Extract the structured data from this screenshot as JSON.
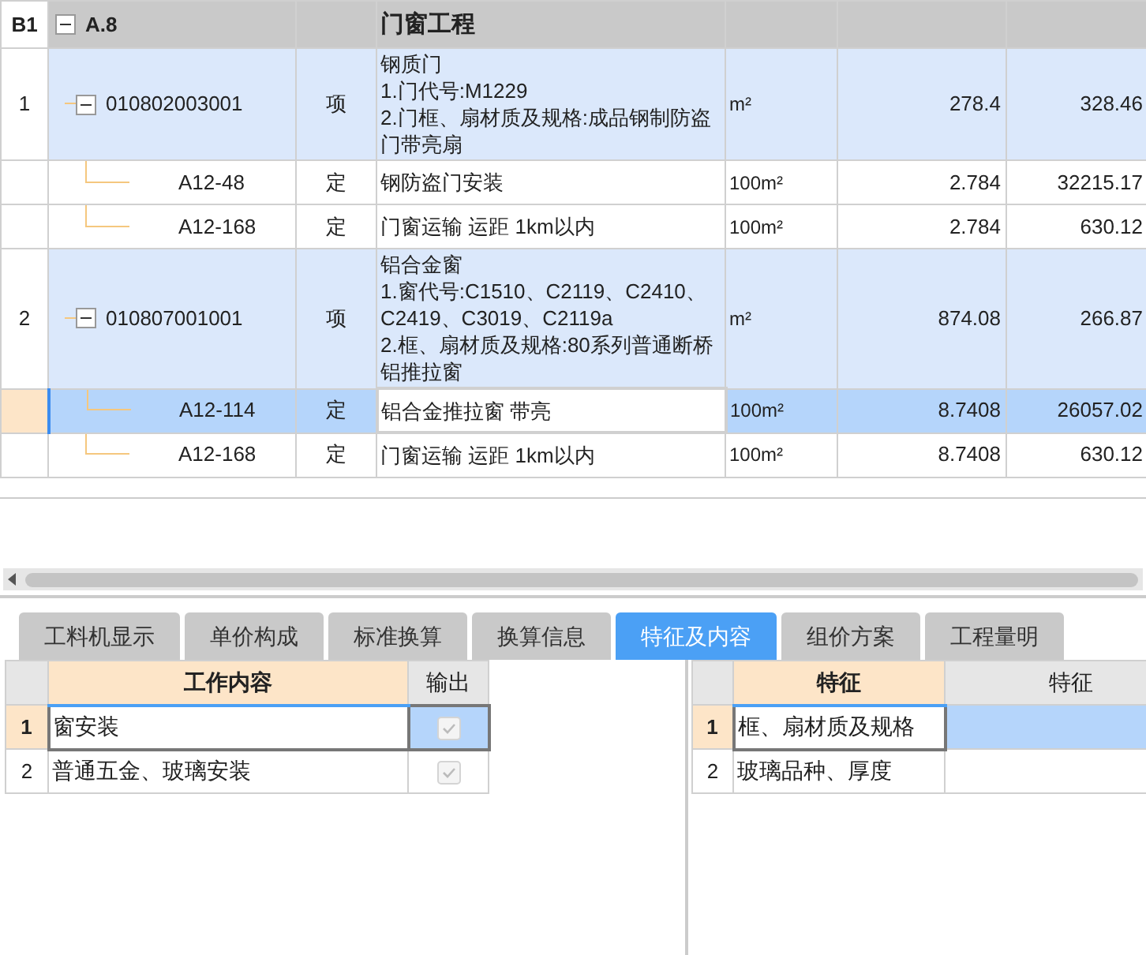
{
  "bill_table": {
    "rows": [
      {
        "kind": "section",
        "number": "B1",
        "code": "A.8",
        "name": "门窗工程",
        "expanded": true,
        "selected": false,
        "children": [
          {
            "kind": "item",
            "number": "1",
            "code": "010802003001",
            "type": "项",
            "name": [
              "钢质门",
              "1.门代号:M1229",
              "2.门框、扇材质及规格:成品钢制防盗门带亮扇"
            ],
            "unit": "m²",
            "quantity": "278.4",
            "price": "328.46",
            "expanded": true,
            "selected": false,
            "children": [
              {
                "kind": "sub",
                "code": "A12-48",
                "type": "定",
                "name": "钢防盗门安装",
                "unit": "100m²",
                "quantity": "2.784",
                "price": "32215.17",
                "selected": false
              },
              {
                "kind": "sub",
                "code": "A12-168",
                "type": "定",
                "name": "门窗运输 运距 1km以内",
                "unit": "100m²",
                "quantity": "2.784",
                "price": "630.12",
                "selected": false
              }
            ]
          },
          {
            "kind": "item",
            "number": "2",
            "code": "010807001001",
            "type": "项",
            "name": [
              "铝合金窗",
              "1.窗代号:C1510、C2119、C2410、C2419、C3019、C2119a",
              "2.框、扇材质及规格:80系列普通断桥铝推拉窗"
            ],
            "unit": "m²",
            "quantity": "874.08",
            "price": "266.87",
            "expanded": true,
            "selected": false,
            "children": [
              {
                "kind": "sub",
                "code": "A12-114",
                "type": "定",
                "name": "铝合金推拉窗 带亮",
                "unit": "100m²",
                "quantity": "8.7408",
                "price": "26057.02",
                "selected": true
              },
              {
                "kind": "sub",
                "code": "A12-168",
                "type": "定",
                "name": "门窗运输 运距 1km以内",
                "unit": "100m²",
                "quantity": "8.7408",
                "price": "630.12",
                "selected": false
              }
            ]
          }
        ]
      }
    ]
  },
  "tabs": [
    {
      "label": "工料机显示",
      "selected": false
    },
    {
      "label": "单价构成",
      "selected": false
    },
    {
      "label": "标准换算",
      "selected": false
    },
    {
      "label": "换算信息",
      "selected": false
    },
    {
      "label": "特征及内容",
      "selected": true
    },
    {
      "label": "组价方案",
      "selected": false
    },
    {
      "label": "工程量明",
      "selected": false
    }
  ],
  "work_table": {
    "columns": [
      "工作内容",
      "输出"
    ],
    "rows": [
      {
        "number": "1",
        "content": "窗安装",
        "checked": true,
        "selected": true
      },
      {
        "number": "2",
        "content": "普通五金、玻璃安装",
        "checked": true,
        "selected": false
      }
    ]
  },
  "feature_table": {
    "columns": [
      "特征",
      "特征"
    ],
    "rows": [
      {
        "number": "1",
        "feature": "框、扇材质及规格",
        "selected": true
      },
      {
        "number": "2",
        "feature": "玻璃品种、厚度",
        "selected": false
      }
    ]
  }
}
